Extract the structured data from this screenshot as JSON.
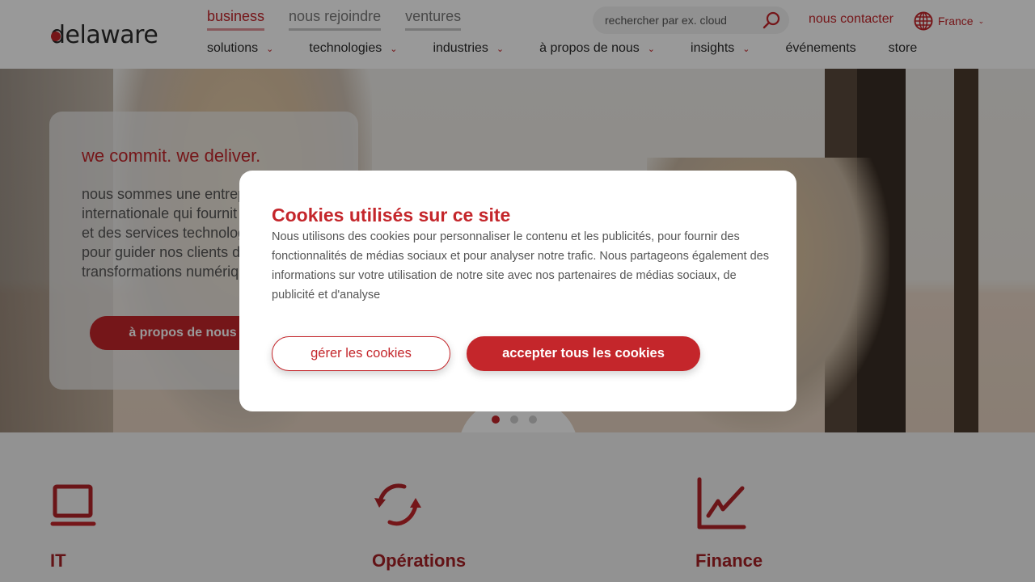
{
  "header": {
    "logo": "delaware",
    "top_tabs": [
      {
        "label": "business",
        "active": true
      },
      {
        "label": "nous rejoindre",
        "active": false
      },
      {
        "label": "ventures",
        "active": false
      }
    ],
    "nav": [
      {
        "label": "solutions",
        "has_dropdown": true
      },
      {
        "label": "technologies",
        "has_dropdown": true
      },
      {
        "label": "industries",
        "has_dropdown": true
      },
      {
        "label": "à propos de nous",
        "has_dropdown": true
      },
      {
        "label": "insights",
        "has_dropdown": true
      },
      {
        "label": "événements",
        "has_dropdown": false
      },
      {
        "label": "store",
        "has_dropdown": false
      }
    ],
    "search": {
      "placeholder": "rechercher par ex. cloud",
      "value": "",
      "icon": "search-icon"
    },
    "contact_label": "nous contacter",
    "language": {
      "label": "France",
      "icon": "globe-icon"
    }
  },
  "hero": {
    "title": "we commit. we deliver.",
    "text": "nous sommes une entreprise internationale qui fournit des solutions et des services technologiques avancés pour guider nos clients dans leurs transformations numériques",
    "visible_text_lines": [
      "nous sommes une ent",
      "internationale qui four",
      "solutions et des servic",
      "technologiques avanc",
      "guider nos clients dan",
      "transformations numé"
    ],
    "cta_label": "à propos de nous",
    "carousel": {
      "total": 3,
      "active_index": 0
    }
  },
  "sectors": [
    {
      "label": "IT",
      "icon": "laptop-icon"
    },
    {
      "label": "Opérations",
      "icon": "refresh-cycle-icon"
    },
    {
      "label": "Finance",
      "icon": "line-chart-icon"
    }
  ],
  "cookie_dialog": {
    "title": "Cookies utilisés sur ce site",
    "body": "Nous utilisons des cookies pour personnaliser le contenu et les publicités, pour fournir des fonctionnalités de médias sociaux et pour analyser notre trafic. Nous partageons également des informations sur votre utilisation de notre site avec nos partenaires de médias sociaux, de publicité et d'analyse",
    "manage_label": "gérer les cookies",
    "accept_label": "accepter tous les cookies"
  },
  "colors": {
    "brand_red": "#c4262b",
    "text_dark": "#2b2b2b",
    "text_body": "#555555",
    "overlay": "rgba(0,0,0,0.40)"
  }
}
